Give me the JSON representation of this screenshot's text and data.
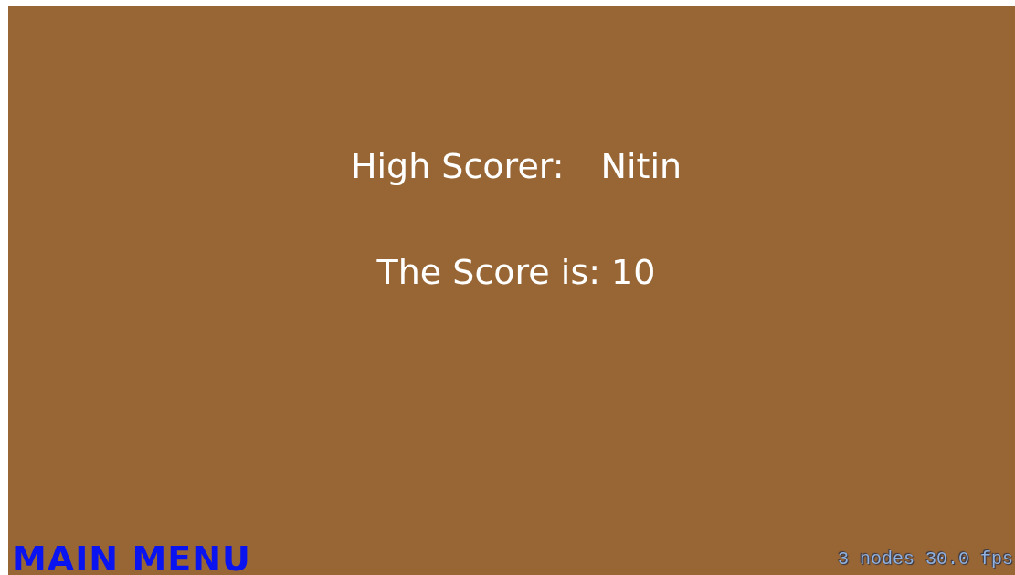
{
  "high_scorer": {
    "label": "High Scorer:",
    "name": "Nitin"
  },
  "score": "The Score is: 10",
  "main_menu": "MAIN MENU",
  "stats": "3 nodes 30.0 fps"
}
